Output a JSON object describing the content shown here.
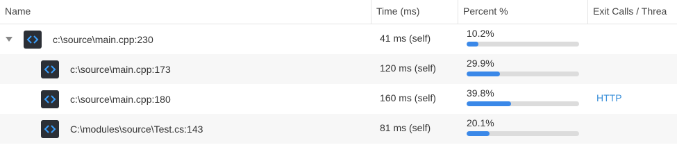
{
  "columns": {
    "name": "Name",
    "time": "Time (ms)",
    "percent": "Percent %",
    "exit": "Exit Calls / Threa"
  },
  "rows": [
    {
      "name": "c:\\source\\main.cpp:230",
      "time": "41 ms (self)",
      "percent_label": "10.2%",
      "percent": 10.2,
      "exit": "",
      "icon": "code-brackets-icon",
      "expandable": true
    },
    {
      "name": "c:\\source\\main.cpp:173",
      "time": "120 ms (self)",
      "percent_label": "29.9%",
      "percent": 29.9,
      "exit": "",
      "icon": "code-brackets-icon",
      "expandable": false
    },
    {
      "name": "c:\\source\\main.cpp:180",
      "time": "160 ms (self)",
      "percent_label": "39.8%",
      "percent": 39.8,
      "exit": "HTTP",
      "icon": "code-brackets-icon",
      "expandable": false
    },
    {
      "name": "C:\\modules\\source\\Test.cs:143",
      "time": "81 ms (self)",
      "percent_label": "20.1%",
      "percent": 20.1,
      "exit": "",
      "icon": "code-brackets-icon",
      "expandable": false
    }
  ],
  "colors": {
    "bar_fill": "#3a88e8",
    "bar_track": "#dcdcdc",
    "link": "#3a8fd9",
    "icon_bg": "#2b2f36",
    "icon_fg": "#3aa0ff"
  }
}
